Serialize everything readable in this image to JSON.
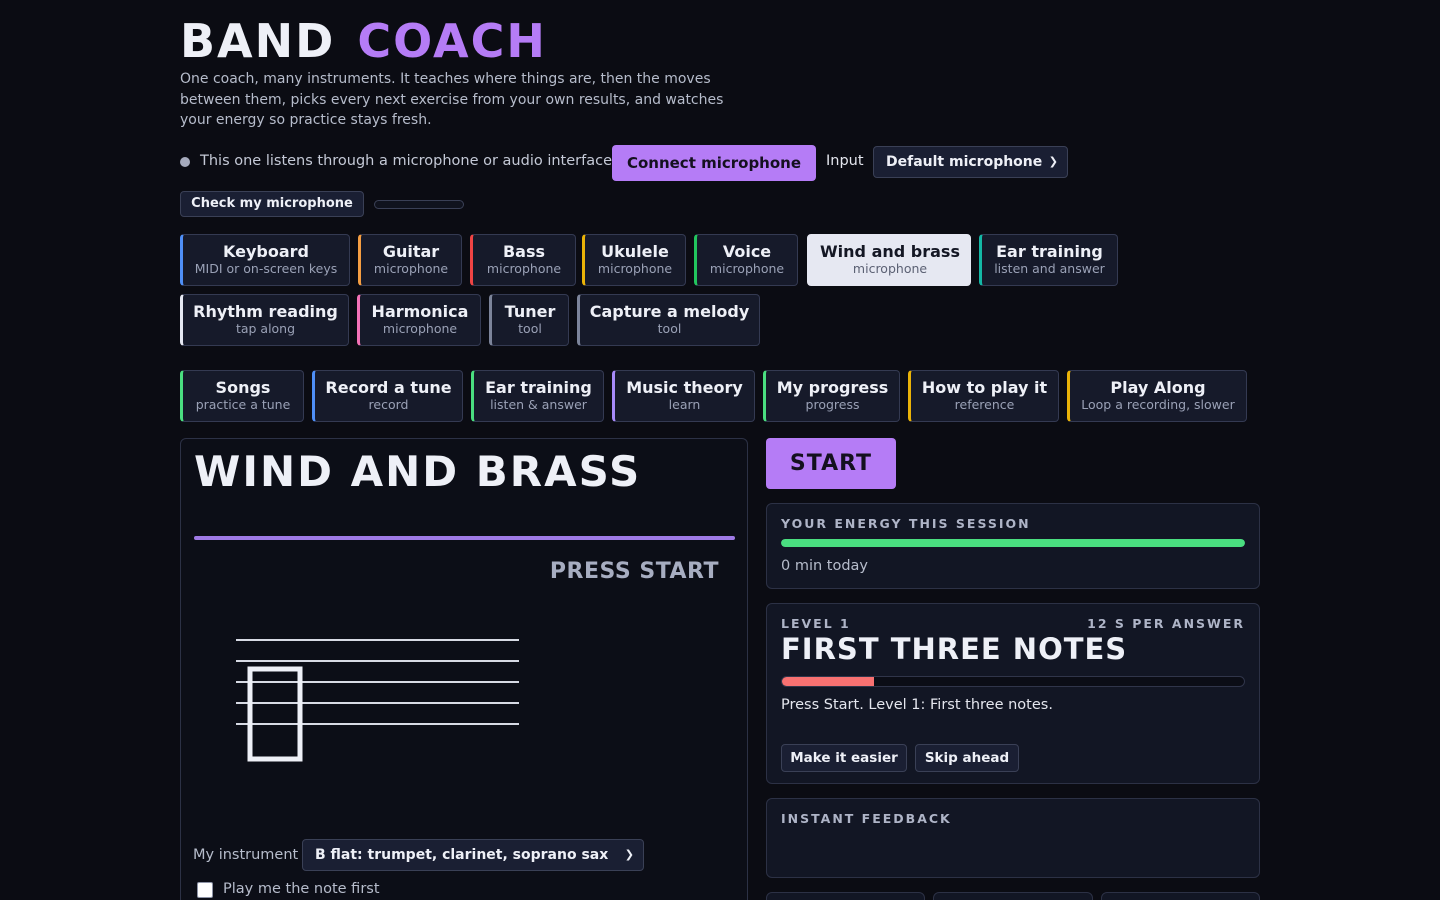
{
  "app": {
    "title_part1": "BAND",
    "title_part2": "COACH",
    "tagline": "One coach, many instruments. It teaches where things are, then the moves between them, picks every next exercise from your own results, and watches your energy so practice stays fresh."
  },
  "mic": {
    "note": "This one listens through a microphone or audio interface.",
    "connect_label": "Connect microphone",
    "input_label": "Input",
    "input_value": "Default microphone",
    "check_label": "Check my microphone",
    "level": 0
  },
  "instruments": [
    {
      "title": "Keyboard",
      "sub": "MIDI or on-screen keys",
      "accent": "#4f8ff7"
    },
    {
      "title": "Guitar",
      "sub": "microphone",
      "accent": "#f59e42"
    },
    {
      "title": "Bass",
      "sub": "microphone",
      "accent": "#ef4444"
    },
    {
      "title": "Ukulele",
      "sub": "microphone",
      "accent": "#eab308"
    },
    {
      "title": "Voice",
      "sub": "microphone",
      "accent": "#22c55e"
    },
    {
      "title": "Wind and brass",
      "sub": "microphone",
      "accent": "#e6e8f2",
      "active": true
    },
    {
      "title": "Ear training",
      "sub": "listen and answer",
      "accent": "#14b8a6"
    },
    {
      "title": "Rhythm reading",
      "sub": "tap along",
      "accent": "#e6e8f2"
    },
    {
      "title": "Harmonica",
      "sub": "microphone",
      "accent": "#f472b6"
    },
    {
      "title": "Tuner",
      "sub": "tool",
      "accent": "#7c849a"
    },
    {
      "title": "Capture a melody",
      "sub": "tool",
      "accent": "#7c849a"
    }
  ],
  "modes": [
    {
      "title": "Songs",
      "sub": "practice a tune",
      "accent": "#4ade80"
    },
    {
      "title": "Record a tune",
      "sub": "record",
      "accent": "#4f8ff7"
    },
    {
      "title": "Ear training",
      "sub": "listen & answer",
      "accent": "#4ade80"
    },
    {
      "title": "Music theory",
      "sub": "learn",
      "accent": "#a78bfa"
    },
    {
      "title": "My progress",
      "sub": "progress",
      "accent": "#4ade80"
    },
    {
      "title": "How to play it",
      "sub": "reference",
      "accent": "#eab308"
    },
    {
      "title": "Play Along",
      "sub": "Loop a recording, slower",
      "accent": "#eab308"
    }
  ],
  "lesson": {
    "title": "WIND AND BRASS",
    "progress": 1.0,
    "prompt": "PRESS START",
    "instrument_label": "My instrument",
    "instrument_value": "B flat: trumpet, clarinet, soprano sax",
    "play_first_label": "Play me the note first"
  },
  "session": {
    "start_label": "START",
    "energy_caption": "YOUR ENERGY THIS SESSION",
    "energy": 1.0,
    "minutes": "0 min today"
  },
  "level": {
    "number": "LEVEL 1",
    "time": "12 S PER ANSWER",
    "title": "FIRST THREE NOTES",
    "progress": 0.2,
    "message": "Press Start. Level 1: First three notes.",
    "easier_label": "Make it easier",
    "skip_label": "Skip ahead"
  },
  "feedback": {
    "caption": "INSTANT FEEDBACK"
  },
  "colors": {
    "accent": "#b57cf6",
    "background": "#0b0c13",
    "energy": "#4ade80",
    "level_bar": "#f87171"
  }
}
